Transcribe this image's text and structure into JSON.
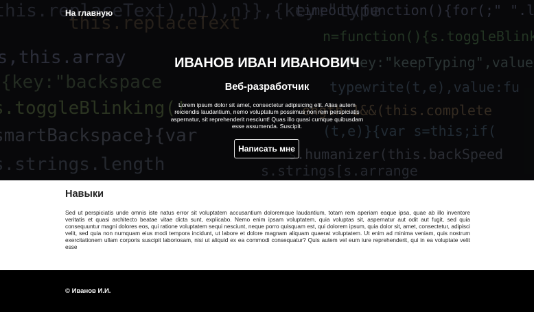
{
  "nav": {
    "home_label": "На главную"
  },
  "hero": {
    "name": "ИВАНОВ ИВАН ИВАНОВИЧ",
    "subtitle": "Веб-разработчик",
    "text": "Lorem ipsum dolor sit amet, consectetur adipisicing elit. Alias autem reiciendis laudantium, nemo voluptatum possimus non rem perspiciatis aspernatur, sit reprehenderit nesciunt! Quas illo quasi cumque quibusdam esse assumenda. Suscipit.",
    "button_label": "Написать мне"
  },
  "skills": {
    "title": "Навыки",
    "text": "Sed ut perspiciatis unde omnis iste natus error sit voluptatem accusantium doloremque laudantium, totam rem aperiam eaque ipsa, quae ab illo inventore veritatis et quasi architecto beatae vitae dicta sunt, explicabo. Nemo enim ipsam voluptatem, quia voluptas sit, aspernatur aut odit aut fugit, sed quia consequuntur magni dolores eos, qui ratione voluptatem sequi nesciunt, neque porro quisquam est, qui dolorem ipsum, quia dolor sit, amet, consectetur, adipisci velit, sed quia non numquam eius modi tempora incidunt, ut labore et dolore magnam aliquam quaerat voluptatem. Ut enim ad minima veniam, quis nostrum exercitationem ullam corporis suscipit laboriosam, nisi ut aliquid ex ea commodi consequatur? Quis autem vel eum iure reprehenderit, qui in ea voluptate velit esse"
  },
  "footer": {
    "copyright": "© Иванов И.И."
  },
  "colors": {
    "hero_bg": "#0e0f12",
    "footer_bg": "#000000",
    "text_dark": "#222222"
  }
}
